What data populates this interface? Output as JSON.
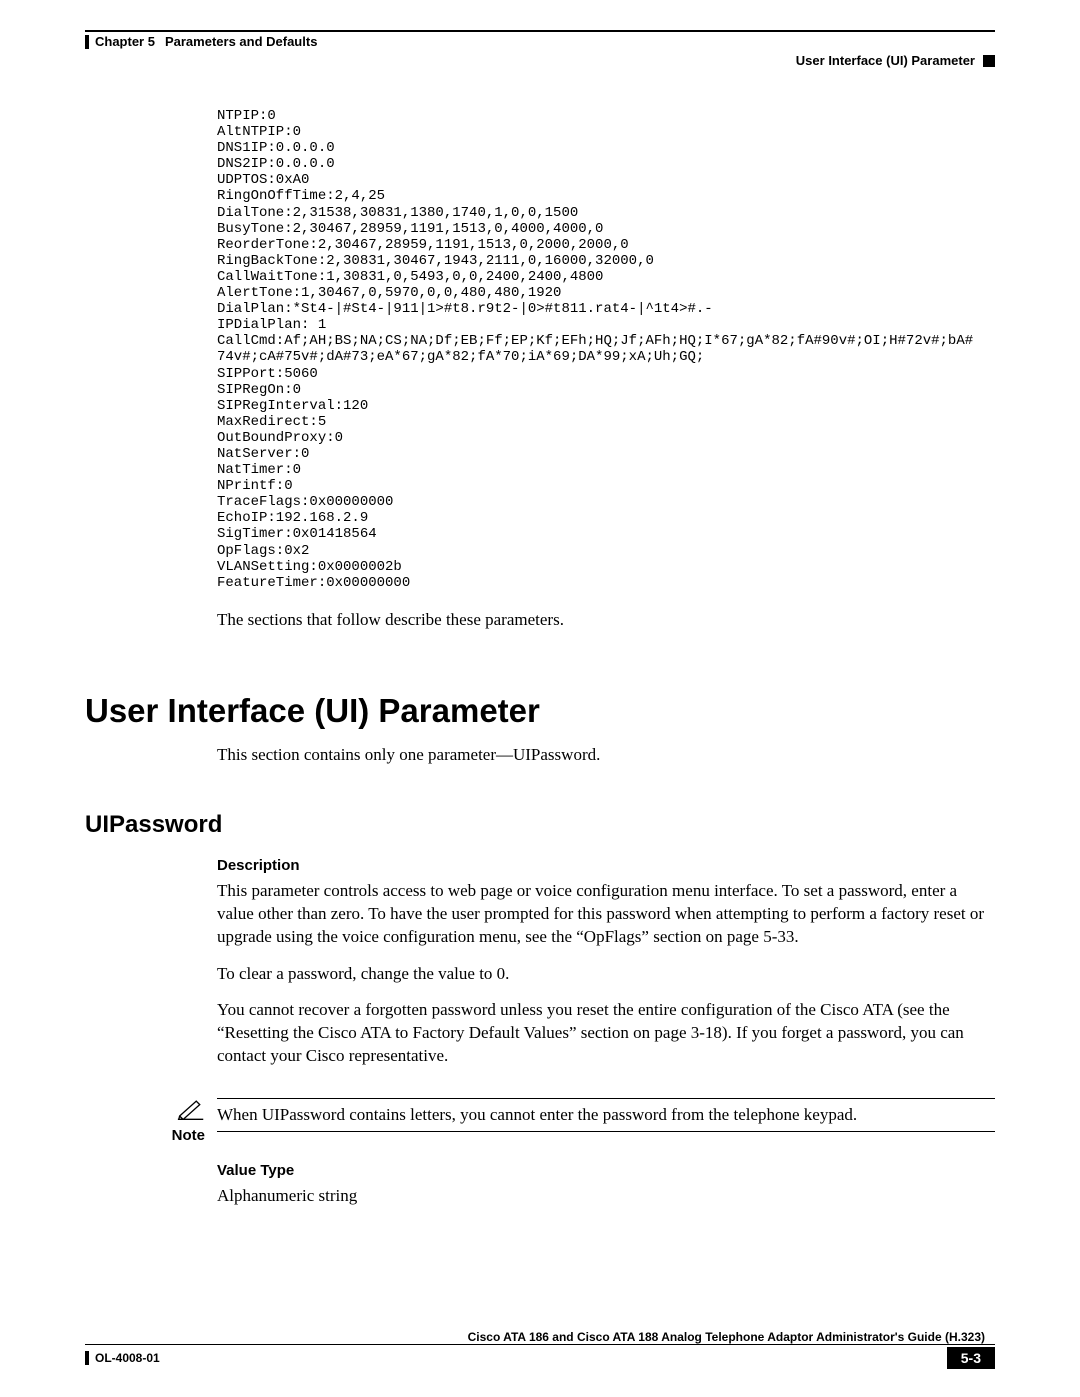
{
  "header": {
    "chapter_label": "Chapter 5",
    "chapter_title": "Parameters and Defaults",
    "right_label": "User Interface (UI) Parameter"
  },
  "code": "NTPIP:0\nAltNTPIP:0\nDNS1IP:0.0.0.0\nDNS2IP:0.0.0.0\nUDPTOS:0xA0\nRingOnOffTime:2,4,25\nDialTone:2,31538,30831,1380,1740,1,0,0,1500\nBusyTone:2,30467,28959,1191,1513,0,4000,4000,0\nReorderTone:2,30467,28959,1191,1513,0,2000,2000,0\nRingBackTone:2,30831,30467,1943,2111,0,16000,32000,0\nCallWaitTone:1,30831,0,5493,0,0,2400,2400,4800\nAlertTone:1,30467,0,5970,0,0,480,480,1920\nDialPlan:*St4-|#St4-|911|1>#t8.r9t2-|0>#t811.rat4-|^1t4>#.-\nIPDialPlan: 1\nCallCmd:Af;AH;BS;NA;CS;NA;Df;EB;Ff;EP;Kf;EFh;HQ;Jf;AFh;HQ;I*67;gA*82;fA#90v#;OI;H#72v#;bA#\n74v#;cA#75v#;dA#73;eA*67;gA*82;fA*70;iA*69;DA*99;xA;Uh;GQ;\nSIPPort:5060\nSIPRegOn:0\nSIPRegInterval:120\nMaxRedirect:5\nOutBoundProxy:0\nNatServer:0\nNatTimer:0\nNPrintf:0\nTraceFlags:0x00000000\nEchoIP:192.168.2.9\nSigTimer:0x01418564\nOpFlags:0x2\nVLANSetting:0x0000002b\nFeatureTimer:0x00000000",
  "body": {
    "intro_after_code": "The sections that follow describe these parameters.",
    "h1": "User Interface (UI) Parameter",
    "h1_intro": "This section contains only one parameter—UIPassword.",
    "h2": "UIPassword",
    "desc_label": "Description",
    "desc_p1": "This parameter controls access to web page or voice configuration menu interface. To set a password, enter a value other than zero. To have the user prompted for this password when attempting to perform a factory reset or upgrade using the voice configuration menu, see the “OpFlags” section on page 5-33.",
    "desc_p2": "To clear a password, change the value to 0.",
    "desc_p3": "You cannot recover a forgotten password unless you reset the entire configuration of the Cisco ATA (see the “Resetting the Cisco ATA to Factory Default Values” section on page 3-18). If you forget a password, you can contact your Cisco representative.",
    "note_label": "Note",
    "note_text": "When UIPassword contains letters, you cannot enter the password from the telephone keypad.",
    "valuetype_label": "Value Type",
    "valuetype_text": "Alphanumeric string"
  },
  "footer": {
    "doc_title": "Cisco ATA 186 and Cisco ATA 188 Analog Telephone Adaptor Administrator's Guide (H.323)",
    "doc_code": "OL-4008-01",
    "page_num": "5-3"
  }
}
